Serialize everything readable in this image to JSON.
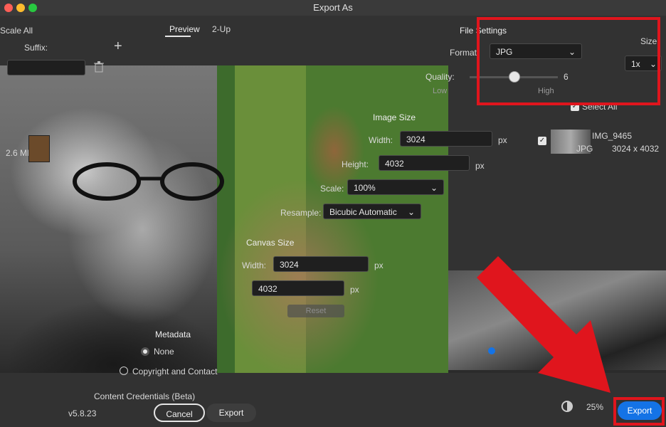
{
  "window": {
    "title": "Export As"
  },
  "left_panel": {
    "scale_all_label": "Scale All",
    "suffix_label": "Suffix:",
    "add_icon": "plus-icon",
    "trash_icon": "trash-icon",
    "file_size": "2.6 MB"
  },
  "tabs": [
    {
      "label": "Preview"
    },
    {
      "label": "2-Up"
    }
  ],
  "file_settings": {
    "heading": "File Settings",
    "format_label": "Format:",
    "format_value": "JPG",
    "quality_label": "Quality:",
    "quality_value": "6",
    "quality_fraction": 0.5,
    "low_label": "Low",
    "high_label": "High",
    "select_all_label": "Select All",
    "size_label": "Size",
    "size_value": "1x"
  },
  "image_size": {
    "heading": "Image Size",
    "width_label": "Width:",
    "width_value": "3024",
    "height_label": "Height:",
    "height_value": "4032",
    "unit": "px",
    "scale_label": "Scale:",
    "scale_value": "100%",
    "resample_label": "Resample:",
    "resample_value": "Bicubic Automatic"
  },
  "canvas_size": {
    "heading": "Canvas Size",
    "width_label": "Width:",
    "width_value": "3024",
    "height_value": "4032",
    "unit": "px",
    "reset_label": "Reset"
  },
  "metadata": {
    "heading": "Metadata",
    "option_none": "None",
    "option_copyright": "Copyright and Contact"
  },
  "content_credentials": "Content Credentials (Beta)",
  "asset": {
    "name": "IMG_9465",
    "format": "JPG",
    "dims": "3024 x 4032"
  },
  "footer": {
    "version": "v5.8.23",
    "cancel_label": "Cancel",
    "export_label": "Export",
    "zoom": "25%",
    "export_all_label": "Export"
  },
  "colors": {
    "annotation_red": "#e0151d",
    "accent_blue": "#1473e6"
  }
}
